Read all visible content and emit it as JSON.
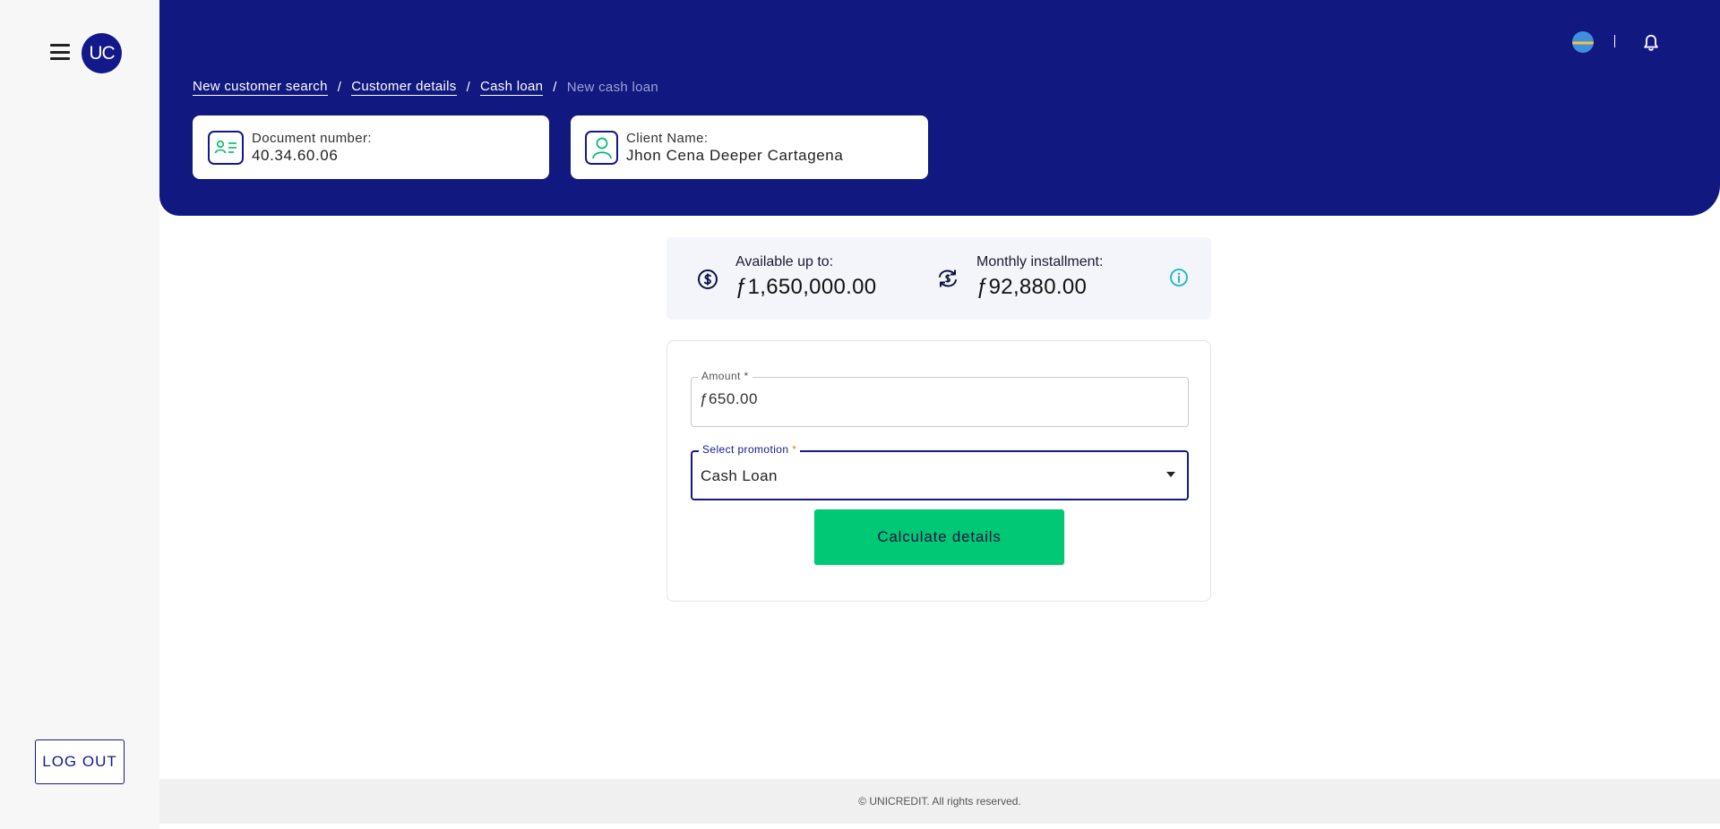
{
  "sidebar": {
    "logo_text": "UC",
    "logout_label": "LOG OUT"
  },
  "header": {
    "breadcrumb": [
      {
        "label": "New customer search"
      },
      {
        "label": "Customer details"
      },
      {
        "label": "Cash loan"
      },
      {
        "label": "New cash loan"
      }
    ],
    "breadcrumb_separator": "/",
    "document_card": {
      "label": "Document number:",
      "value": "40.34.60.06"
    },
    "client_card": {
      "label": "Client Name:",
      "value": "Jhon Cena Deeper Cartagena"
    }
  },
  "summary": {
    "available_label": "Available up to:",
    "available_value": "ƒ1,650,000.00",
    "installment_label": "Monthly installment:",
    "installment_value": "ƒ92,880.00"
  },
  "form": {
    "amount_label": "Amount",
    "amount_value": "ƒ650.00",
    "promotion_label": "Select promotion",
    "promotion_value": "Cash Loan",
    "required_mark": "*",
    "calculate_label": "Calculate details"
  },
  "footer": {
    "copyright": "© UNICREDIT. All rights reserved."
  },
  "colors": {
    "brand_navy": "#11187f",
    "accent_green": "#00c875",
    "info_teal": "#13b5c8"
  },
  "icons": {
    "menu": "hamburger-menu-icon",
    "language": "globe-flag-icon",
    "notifications": "bell-icon",
    "document": "id-card-icon",
    "client": "user-icon",
    "available": "dollar-coin-icon",
    "installment": "refresh-dollar-icon",
    "info": "info-icon"
  }
}
